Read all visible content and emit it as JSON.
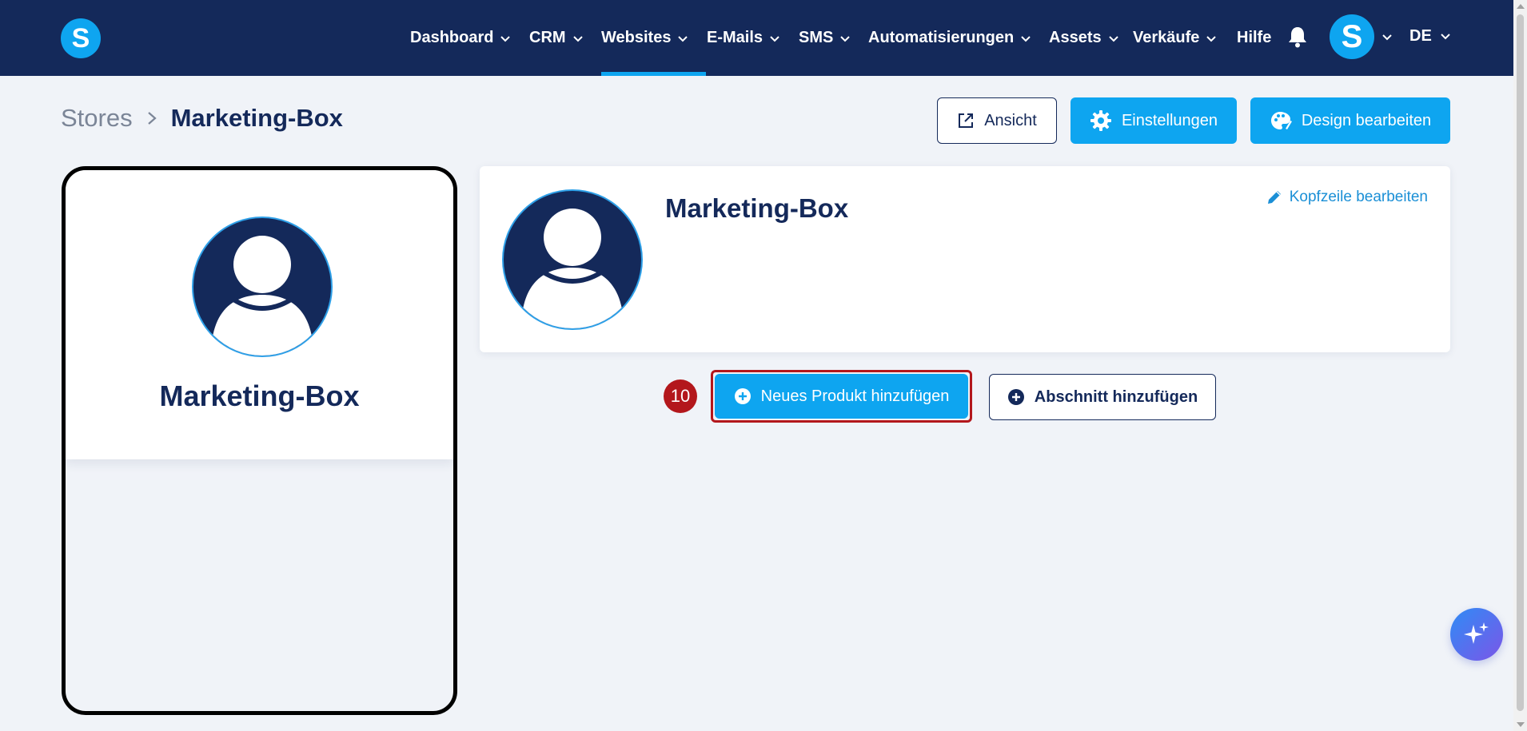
{
  "logo": {
    "letter": "S"
  },
  "nav": {
    "items": [
      {
        "label": "Dashboard",
        "has_menu": true
      },
      {
        "label": "CRM",
        "has_menu": true
      },
      {
        "label": "Websites",
        "has_menu": true,
        "active": true
      },
      {
        "label": "E-Mails",
        "has_menu": true
      },
      {
        "label": "SMS",
        "has_menu": true
      },
      {
        "label": "Automatisierungen",
        "has_menu": true
      },
      {
        "label": "Assets",
        "has_menu": true
      },
      {
        "label": "Verkäufe",
        "has_menu": true
      },
      {
        "label": "Hilfe",
        "has_menu": false
      }
    ],
    "avatar_letter": "S",
    "language": "DE"
  },
  "breadcrumb": {
    "root": "Stores",
    "current": "Marketing-Box"
  },
  "toolbar": {
    "view_label": "Ansicht",
    "settings_label": "Einstellungen",
    "design_label": "Design bearbeiten"
  },
  "preview": {
    "title": "Marketing-Box"
  },
  "header_card": {
    "title": "Marketing-Box",
    "edit_label": "Kopfzeile bearbeiten"
  },
  "actions": {
    "step_number": "10",
    "add_product_label": "Neues Produkt hinzufügen",
    "add_section_label": "Abschnitt hinzufügen"
  },
  "colors": {
    "navy": "#14295a",
    "accent": "#0ea5f0",
    "link": "#1a8fd6",
    "highlight": "#b3171c",
    "background": "#f0f3f8"
  }
}
